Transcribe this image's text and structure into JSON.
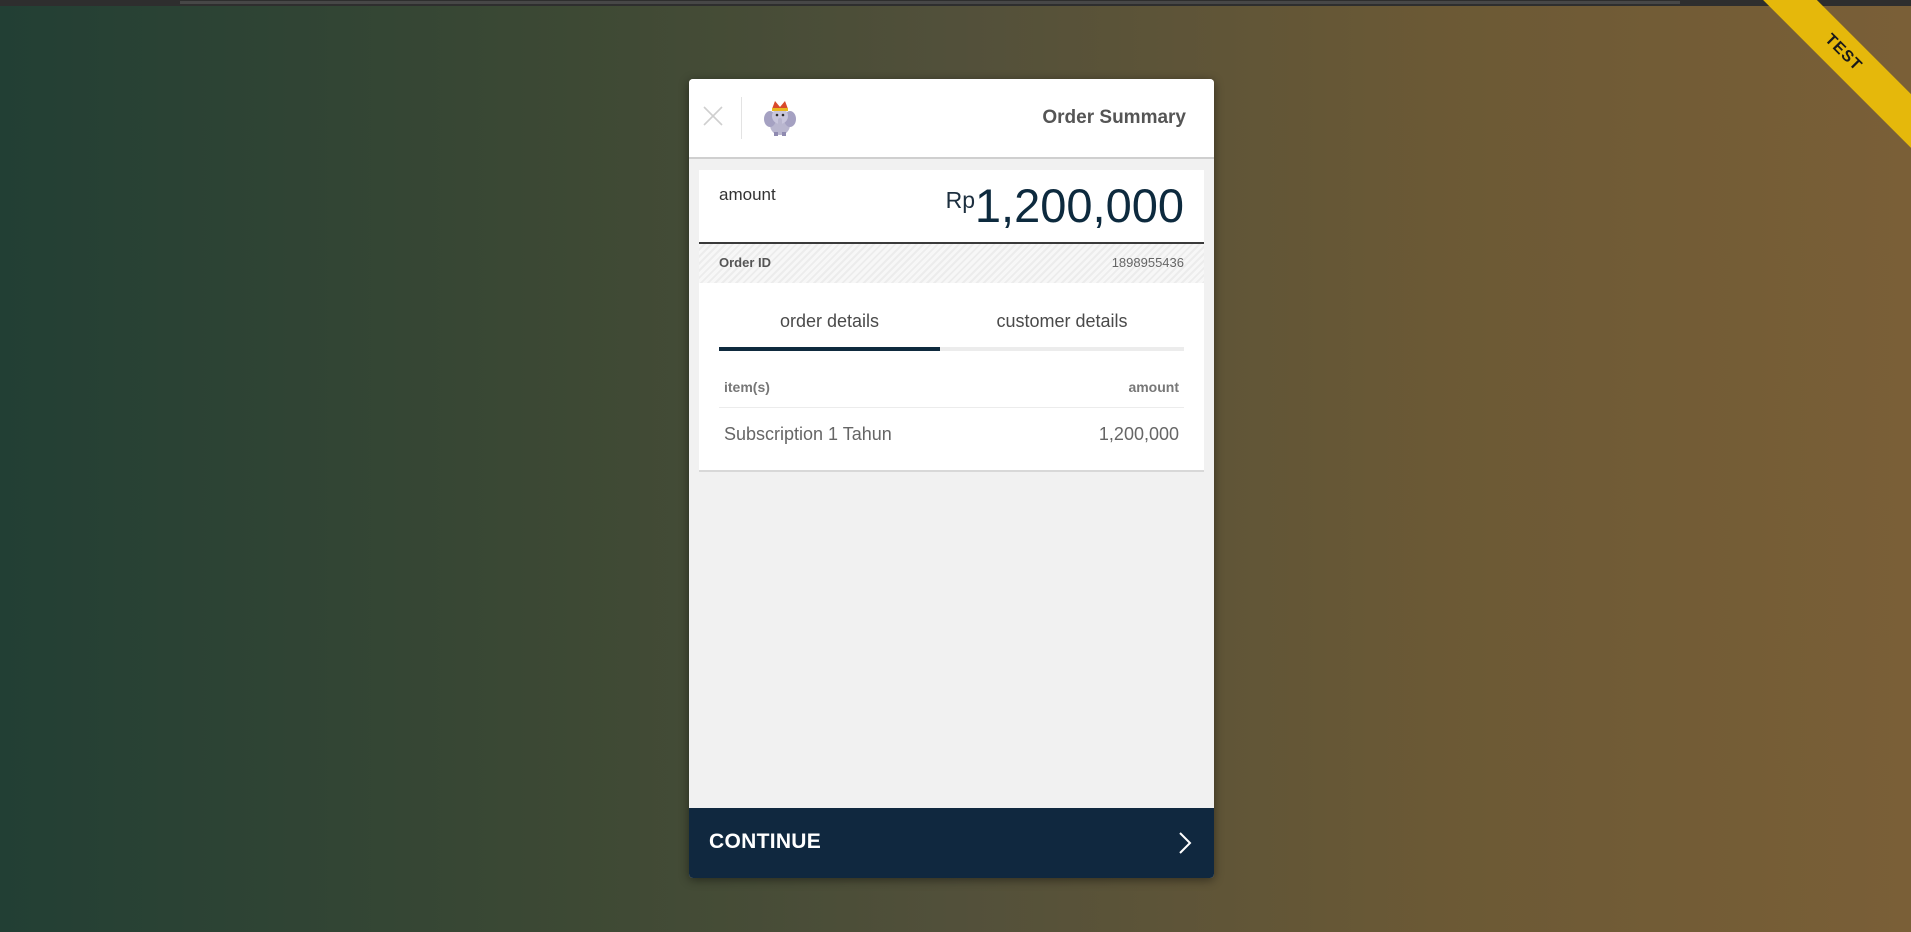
{
  "ribbon": {
    "label": "TEST",
    "color": "#e5b80b"
  },
  "header": {
    "title": "Order Summary",
    "close_icon": "close-icon",
    "logo": "merchant-logo"
  },
  "amount": {
    "label": "amount",
    "currency": "Rp",
    "value": "1,200,000"
  },
  "order": {
    "id_label": "Order ID",
    "id_value": "1898955436"
  },
  "tabs": [
    {
      "label": "order details",
      "active": true
    },
    {
      "label": "customer details",
      "active": false
    }
  ],
  "table": {
    "headers": {
      "item": "item(s)",
      "amount": "amount"
    },
    "rows": [
      {
        "item": "Subscription 1 Tahun",
        "amount": "1,200,000"
      }
    ]
  },
  "footer": {
    "continue_label": "CONTINUE",
    "icon": "chevron-right-icon",
    "color": "#10283f"
  }
}
